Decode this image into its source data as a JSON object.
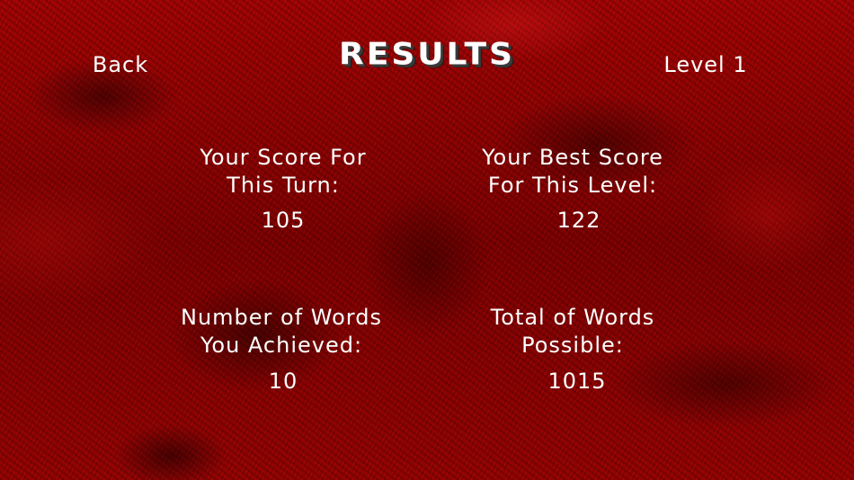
{
  "header": {
    "back_label": "Back",
    "title": "RESULTS",
    "level_label": "Level 1"
  },
  "stats": {
    "score_turn": {
      "label_line1": "Your Score For",
      "label_line2": "This Turn:",
      "value": "105"
    },
    "best_score": {
      "label_line1": "Your Best Score",
      "label_line2": "For This Level:",
      "value": "122"
    },
    "words_achieved": {
      "label_line1": "Number of Words",
      "label_line2": "You Achieved:",
      "value": "10"
    },
    "words_possible": {
      "label_line1": "Total of Words",
      "label_line2": "Possible:",
      "value": "1015"
    }
  },
  "colors": {
    "background": "#8a0000",
    "text": "#ffffff"
  }
}
